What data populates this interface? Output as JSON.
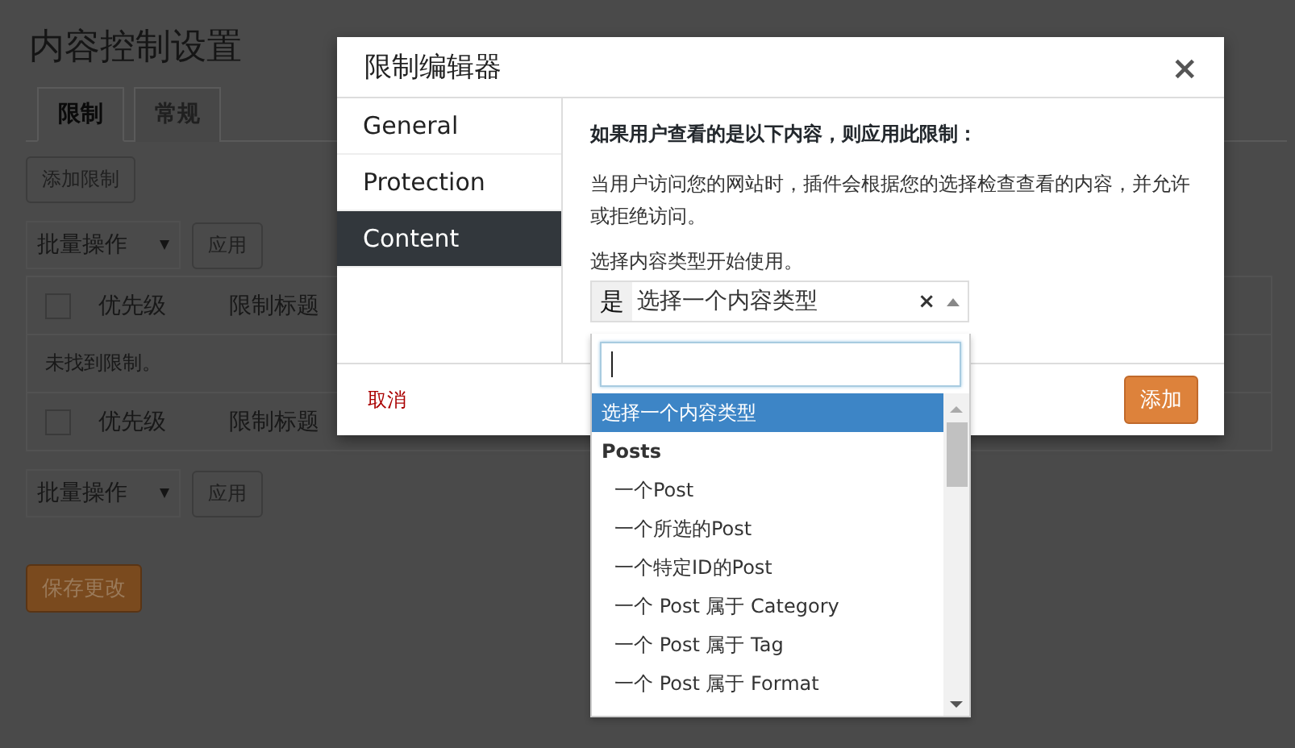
{
  "page": {
    "title": "内容控制设置",
    "tabs": [
      {
        "label": "限制",
        "selected": true
      },
      {
        "label": "常规",
        "selected": false
      }
    ],
    "add_button": "添加限制",
    "bulk_top": {
      "value": "批量操作",
      "apply": "应用"
    },
    "table": {
      "select_all": {
        "checked": false
      },
      "columns": [
        "优先级",
        "限制标题"
      ],
      "empty_message": "未找到限制。",
      "footer_select_all": {
        "checked": false
      },
      "footer_columns": [
        "优先级",
        "限制标题"
      ]
    },
    "bulk_bottom": {
      "value": "批量操作",
      "apply": "应用"
    },
    "save_button": "保存更改"
  },
  "modal": {
    "title": "限制编辑器",
    "close": "×",
    "sidebar": [
      {
        "label": "General",
        "selected": false
      },
      {
        "label": "Protection",
        "selected": false
      },
      {
        "label": "Content",
        "selected": true
      }
    ],
    "heading": "如果用户查看的是以下内容，则应用此限制：",
    "description": "当用户访问您的网站时，插件会根据您的选择检查查看的内容，并允许或拒绝访问。",
    "select_label": "选择内容类型开始使用。",
    "select": {
      "prefix": "是",
      "placeholder": "选择一个内容类型",
      "clear": "×",
      "expanded": true
    },
    "dropdown": {
      "search": {
        "focused": true
      },
      "options": [
        {
          "kind": "option",
          "label": "选择一个内容类型",
          "selected": true
        },
        {
          "kind": "group",
          "label": "Posts",
          "selected": false
        },
        {
          "kind": "child",
          "label": "一个Post",
          "selected": false
        },
        {
          "kind": "child",
          "label": "一个所选的Post",
          "selected": false
        },
        {
          "kind": "child",
          "label": "一个特定ID的Post",
          "selected": false
        },
        {
          "kind": "child",
          "label": "一个 Post 属于 Category",
          "selected": false
        },
        {
          "kind": "child",
          "label": "一个 Post 属于 Tag",
          "selected": false
        },
        {
          "kind": "child",
          "label": "一个 Post 属于 Format",
          "selected": false
        }
      ]
    },
    "cancel": "取消",
    "add": "添加"
  }
}
